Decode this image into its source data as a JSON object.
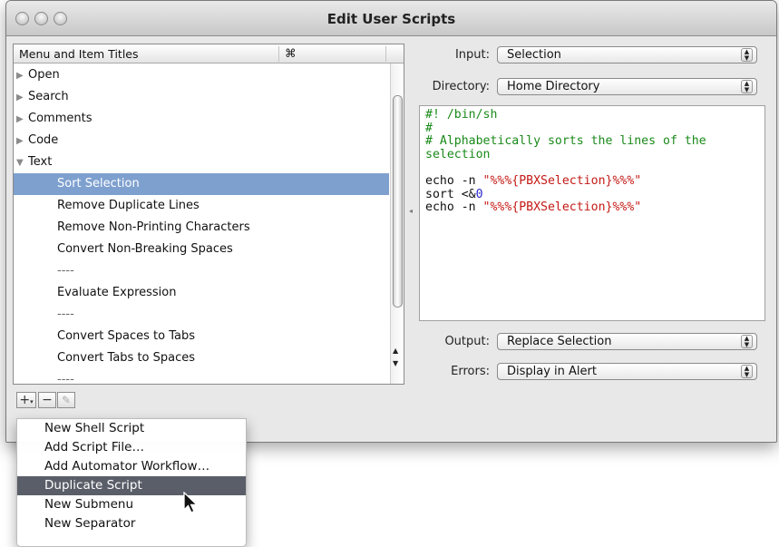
{
  "window": {
    "title": "Edit User Scripts"
  },
  "table": {
    "headers": [
      "Menu and Item Titles",
      "⌘"
    ],
    "rows": [
      {
        "label": "Open",
        "kind": "group",
        "expanded": false
      },
      {
        "label": "Search",
        "kind": "group",
        "expanded": false
      },
      {
        "label": "Comments",
        "kind": "group",
        "expanded": false
      },
      {
        "label": "Code",
        "kind": "group",
        "expanded": false
      },
      {
        "label": "Text",
        "kind": "group",
        "expanded": true
      },
      {
        "label": "Sort Selection",
        "kind": "child",
        "selected": true
      },
      {
        "label": "Remove Duplicate Lines",
        "kind": "child"
      },
      {
        "label": "Remove Non-Printing Characters",
        "kind": "child"
      },
      {
        "label": "Convert Non-Breaking Spaces",
        "kind": "child"
      },
      {
        "label": "----",
        "kind": "separator"
      },
      {
        "label": "Evaluate Expression",
        "kind": "child"
      },
      {
        "label": "----",
        "kind": "separator"
      },
      {
        "label": "Convert Spaces to Tabs",
        "kind": "child"
      },
      {
        "label": "Convert Tabs to Spaces",
        "kind": "child"
      },
      {
        "label": "----",
        "kind": "separator"
      }
    ]
  },
  "buttons": {
    "add": "+",
    "remove": "−",
    "edit": "✎"
  },
  "form": {
    "input_label": "Input:",
    "input_value": "Selection",
    "directory_label": "Directory:",
    "directory_value": "Home Directory",
    "output_label": "Output:",
    "output_value": "Replace Selection",
    "errors_label": "Errors:",
    "errors_value": "Display in Alert"
  },
  "script": {
    "lines": [
      "#! /bin/sh",
      "#",
      "# Alphabetically sorts the lines of the",
      "selection",
      "",
      "echo -n \"%%%{PBXSelection}%%%\"",
      "sort <&0",
      "echo -n \"%%%{PBXSelection}%%%\""
    ]
  },
  "menu": {
    "items": [
      "New Shell Script",
      "Add Script File…",
      "Add Automator Workflow…",
      "Duplicate Script",
      "New Submenu",
      "New Separator"
    ],
    "highlighted": "Duplicate Script"
  },
  "colors": {
    "selection": "#7ea0cf",
    "menu_highlight": "#5a5e68",
    "comment": "#1a8a1a",
    "string": "#c41a16"
  }
}
